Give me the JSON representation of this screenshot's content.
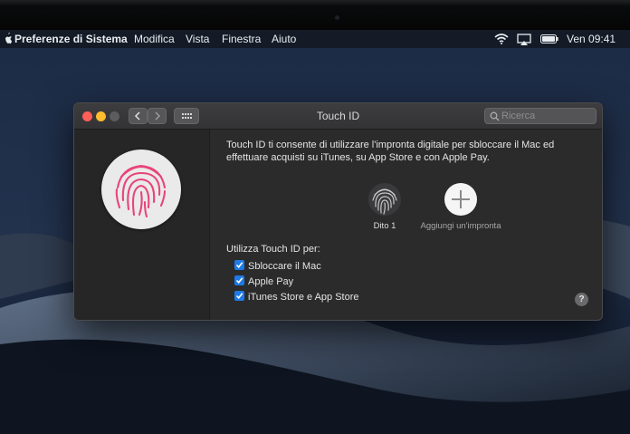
{
  "menubar": {
    "app_name": "Preferenze di Sistema",
    "menus": [
      "Modifica",
      "Vista",
      "Finestra",
      "Aiuto"
    ],
    "clock": "Ven 09:41",
    "status_icons": [
      "wifi-icon",
      "airplay-icon",
      "battery-icon"
    ]
  },
  "window": {
    "title": "Touch ID",
    "search_placeholder": "Ricerca",
    "description": "Touch ID ti consente di utilizzare l'impronta digitale per sbloccare il Mac ed effettuare acquisti su iTunes, su App Store e con Apple Pay.",
    "fingerprints": [
      {
        "label": "Dito 1"
      }
    ],
    "add_fingerprint_label": "Aggiungi un'impronta",
    "use_title": "Utilizza Touch ID per:",
    "options": [
      {
        "label": "Sbloccare il Mac",
        "checked": true
      },
      {
        "label": "Apple Pay",
        "checked": true
      },
      {
        "label": "iTunes Store e App Store",
        "checked": true
      }
    ],
    "help_symbol": "?"
  },
  "colors": {
    "close": "#fe5f57",
    "minimize": "#febc2e",
    "zoom_disabled": "#5c5c5e",
    "checkbox": "#1e7ae6",
    "fingerprint_accent": "#e8457a"
  }
}
